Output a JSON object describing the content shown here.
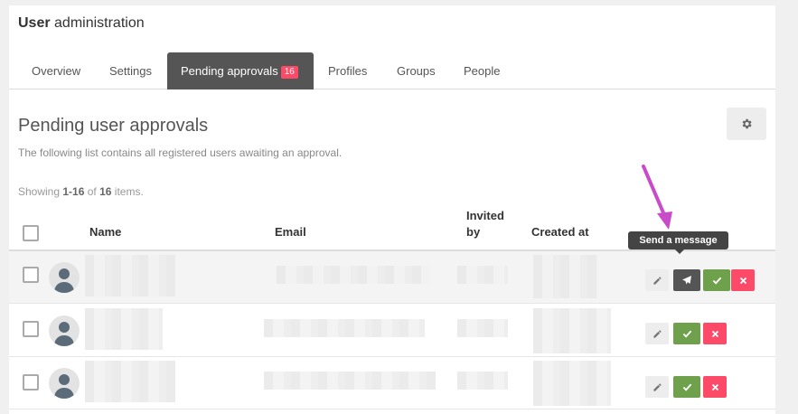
{
  "header": {
    "title_bold": "User",
    "title_rest": " administration"
  },
  "tabs": [
    {
      "label": "Overview"
    },
    {
      "label": "Settings"
    },
    {
      "label": "Pending approvals",
      "badge": "16",
      "active": true
    },
    {
      "label": "Profiles"
    },
    {
      "label": "Groups"
    },
    {
      "label": "People"
    }
  ],
  "section": {
    "title": "Pending user approvals",
    "description": "The following list contains all registered users awaiting an approval."
  },
  "summary": {
    "prefix": "Showing ",
    "range": "1-16",
    "middle": " of ",
    "total": "16",
    "suffix": " items."
  },
  "table": {
    "columns": {
      "name": "Name",
      "email": "Email",
      "invited_line1": "Invited",
      "invited_line2": "by",
      "created": "Created at"
    }
  },
  "tooltip": {
    "text": "Send a message"
  },
  "icons": {
    "gear": "gear-icon",
    "pencil": "pencil-icon",
    "send": "paper-plane-icon",
    "check": "check-icon",
    "close": "close-icon",
    "avatar": "user-avatar-icon",
    "arrow": "annotation-arrow"
  },
  "colors": {
    "accent_active_tab": "#555555",
    "badge": "#fc4a68",
    "approve": "#6fa04b",
    "decline": "#fc4a68",
    "annotation": "#c94bc9"
  }
}
